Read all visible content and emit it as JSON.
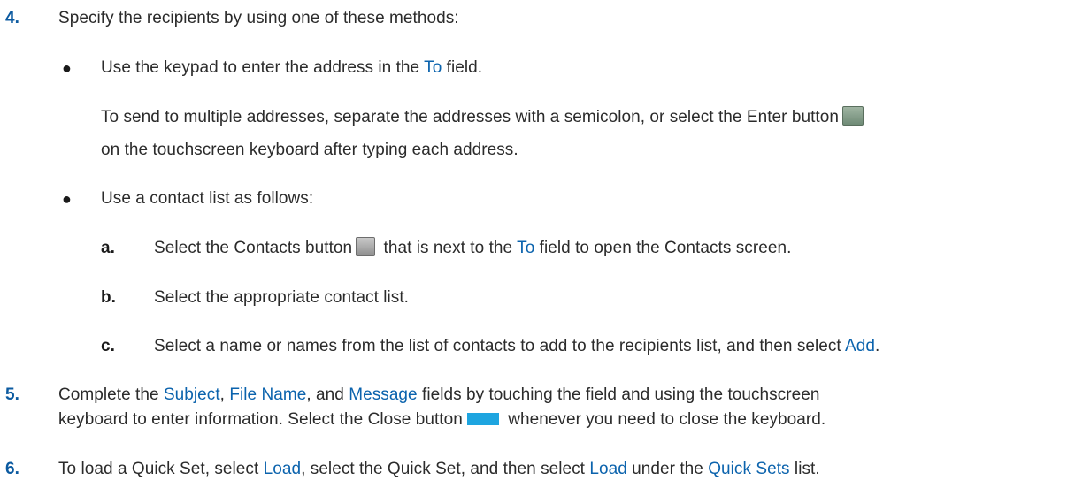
{
  "step4": {
    "num": "4.",
    "text": "Specify the recipients by using one of these methods:"
  },
  "bullet1": {
    "pre": "Use the keypad to enter the address in the ",
    "to": "To",
    "post": " field."
  },
  "para1": {
    "line1": "To send to multiple addresses, separate the addresses with a semicolon, or select the Enter button",
    "line2": "on the touchscreen keyboard after typing each address."
  },
  "bullet2": {
    "text": "Use a contact list as follows:"
  },
  "sub_a": {
    "letter": "a.",
    "pre": "Select the Contacts button",
    "mid": " that is next to the ",
    "to": "To",
    "post": " field to open the Contacts screen."
  },
  "sub_b": {
    "letter": "b.",
    "text": "Select the appropriate contact list."
  },
  "sub_c": {
    "letter": "c.",
    "pre": "Select a name or names from the list of contacts to add to the recipients list, and then select ",
    "add": "Add",
    "post": "."
  },
  "step5": {
    "num": "5.",
    "pre": "Complete the ",
    "subject": "Subject",
    "sep1": ", ",
    "filename": "File Name",
    "sep2": ", and ",
    "message": "Message",
    "post": " fields by touching the field and using the touchscreen",
    "line2_pre": "keyboard to enter information. Select the Close button",
    "line2_post": " whenever you need to close the keyboard."
  },
  "step6": {
    "num": "6.",
    "pre": "To load a Quick Set, select ",
    "load1": "Load",
    "mid": ", select the Quick Set, and then select ",
    "load2": "Load",
    "mid2": " under the ",
    "quicksets": "Quick Sets",
    "post": " list."
  },
  "icons": {
    "enter": "enter-button-icon",
    "contacts": "contacts-button-icon",
    "close": "close-keyboard-button-icon"
  },
  "colors": {
    "step_number": "#0b5aa0",
    "ui_term": "#0b63ad",
    "body_text": "#2b2b2b",
    "enter_icon": "#7f9a85",
    "contacts_icon": "#a8a8a8",
    "close_icon": "#1ea5e0"
  }
}
